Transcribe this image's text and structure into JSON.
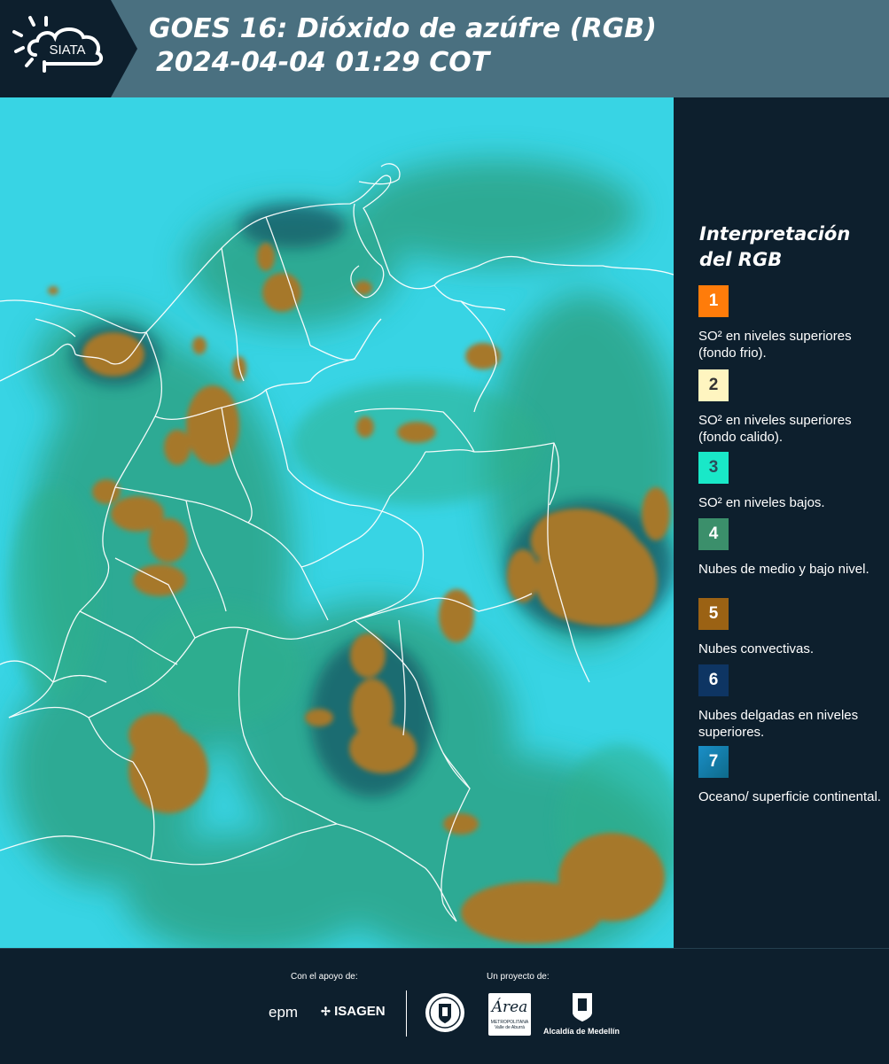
{
  "header": {
    "logo_text": "SIATA",
    "title_line1": "GOES 16: Dióxido de azúfre (RGB)",
    "title_line2": "2024-04-04 01:29 COT",
    "background": "#4a7080",
    "logo_background": "#0d1f2d"
  },
  "map": {
    "region": "Colombia",
    "colors": {
      "ocean_surface": "#2fd8ea",
      "low_mid_clouds": "#2fa27a",
      "convective_clouds": "#a6782c",
      "thin_high_clouds": "#0e3a55",
      "borders": "#ffffff"
    }
  },
  "legend": {
    "title": "Interpretación del RGB",
    "items": [
      {
        "number": "1",
        "label": "SO² en niveles superiores (fondo frio).",
        "color": "#ff7c0a"
      },
      {
        "number": "2",
        "label": "SO² en niveles superiores (fondo calido).",
        "color": "#fff5c0"
      },
      {
        "number": "3",
        "label": "SO² en niveles bajos.",
        "color": "#19e8c8"
      },
      {
        "number": "4",
        "label": "Nubes de medio y bajo nivel.",
        "color": "#3b8f6b"
      },
      {
        "number": "5",
        "label": "Nubes convectivas.",
        "color": "#9b6214"
      },
      {
        "number": "6",
        "label": "Nubes delgadas en niveles superiores.",
        "color": "#0e3563"
      },
      {
        "number": "7",
        "label": "Oceano/ superficie continental.",
        "color": "#1a8fc8"
      }
    ]
  },
  "footer": {
    "support_label": "Con el apoyo de:",
    "project_label": "Un proyecto de:",
    "sponsors": [
      "epm",
      "ISAGEN"
    ],
    "partners": [
      "Área Metropolitana Valle de Aburrá",
      "Alcaldía de Medellín"
    ],
    "area_logo_text": "Área",
    "area_sub1": "METROPOLITANA",
    "area_sub2": "Valle de Aburrá",
    "alcaldia_text": "Alcaldía de Medellín"
  }
}
